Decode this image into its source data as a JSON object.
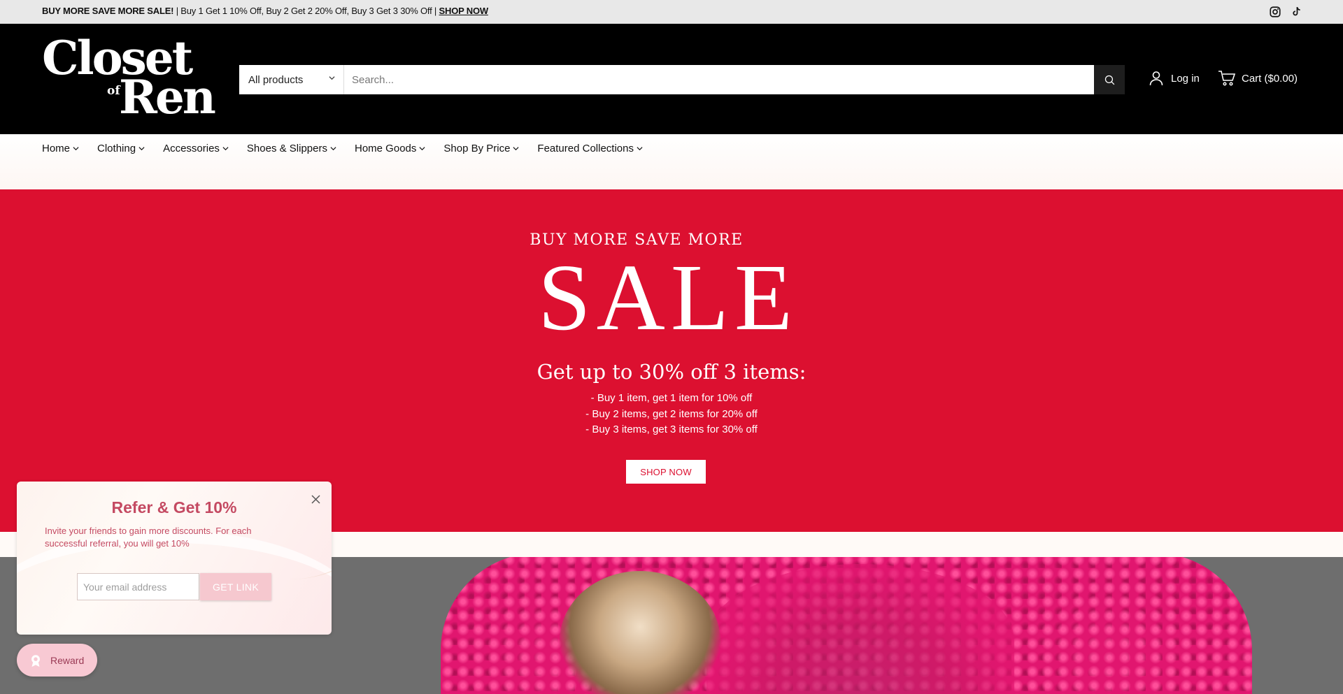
{
  "announcement": {
    "bold": "BUY MORE SAVE MORE SALE!",
    "text": " | Buy 1 Get 1 10% Off, Buy 2 Get 2 20% Off, Buy 3 Get 3 30% Off | ",
    "link": "SHOP NOW"
  },
  "social": [
    "instagram-icon",
    "tiktok-icon"
  ],
  "logo": {
    "line1": "Closet",
    "line2": "of",
    "line3": "Ren"
  },
  "search": {
    "category": "All products",
    "placeholder": "Search..."
  },
  "account": {
    "login_label": "Log in",
    "cart_label": "Cart ($0.00)"
  },
  "nav": {
    "items": [
      {
        "label": "Home"
      },
      {
        "label": "Clothing"
      },
      {
        "label": "Accessories"
      },
      {
        "label": "Shoes & Slippers"
      },
      {
        "label": "Home Goods"
      },
      {
        "label": "Shop By Price"
      },
      {
        "label": "Featured Collections"
      }
    ]
  },
  "hero": {
    "kicker": "BUY MORE SAVE MORE",
    "title": "SALE",
    "subtitle": "Get up to 30% off 3 items:",
    "lines": [
      "- Buy 1 item, get 1 item for 10% off",
      "- Buy 2 items, get 2 items for 20% off",
      "- Buy 3 items, get 3 items for 30% off"
    ],
    "button": "SHOP NOW"
  },
  "refer": {
    "title": "Refer & Get 10%",
    "description": "Invite your friends to gain more discounts. For each successful referral, you will get 10%",
    "email_placeholder": "Your email address",
    "button": "GET LINK"
  },
  "reward": {
    "label": "Reward"
  },
  "colors": {
    "hero_red": "#dc1030",
    "header_black": "#000000",
    "refer_pink": "#c44a62"
  }
}
